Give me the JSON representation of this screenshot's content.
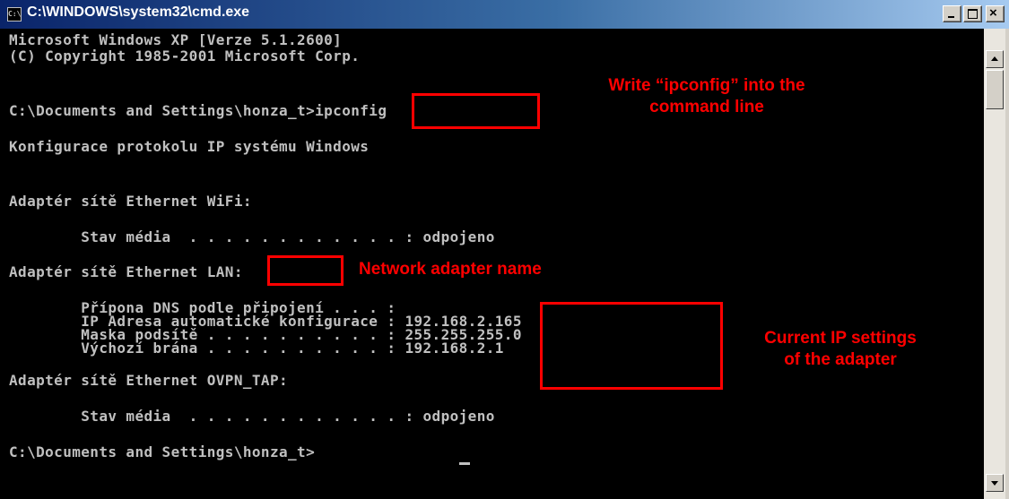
{
  "window": {
    "title": "C:\\WINDOWS\\system32\\cmd.exe",
    "icon_label": "C:\\",
    "buttons": {
      "minimize": "minimize-icon",
      "maximize": "maximize-icon",
      "close": "×"
    }
  },
  "console": {
    "lines": [
      "Microsoft Windows XP [Verze 5.1.2600]",
      "(C) Copyright 1985-2001 Microsoft Corp.",
      "C:\\Documents and Settings\\honza_t>ipconfig",
      "Konfigurace protokolu IP systému Windows",
      "Adaptér sítě Ethernet WiFi:",
      "        Stav média  . . . . . . . . . . . . : odpojeno",
      "Adaptér sítě Ethernet LAN:",
      "        Přípona DNS podle připojení . . . :",
      "        IP Adresa automatické konfigurace : 192.168.2.165",
      "        Maska podsítě . . . . . . . . . . : 255.255.255.0",
      "        Výchozí brána . . . . . . . . . . : 192.168.2.1",
      "Adaptér sítě Ethernet OVPN_TAP:",
      "        Stav média  . . . . . . . . . . . . : odpojeno",
      "C:\\Documents and Settings\\honza_t>"
    ]
  },
  "annotations": {
    "command": [
      "Write “ipconfig” into the",
      "command line"
    ],
    "adapter": "Network adapter name",
    "ip": [
      "Current IP settings",
      "of the adapter"
    ]
  },
  "colors": {
    "console_bg": "#000000",
    "console_text": "#c0c0c0",
    "annotation": "#ff0000",
    "title_bar": "#0a246a"
  }
}
